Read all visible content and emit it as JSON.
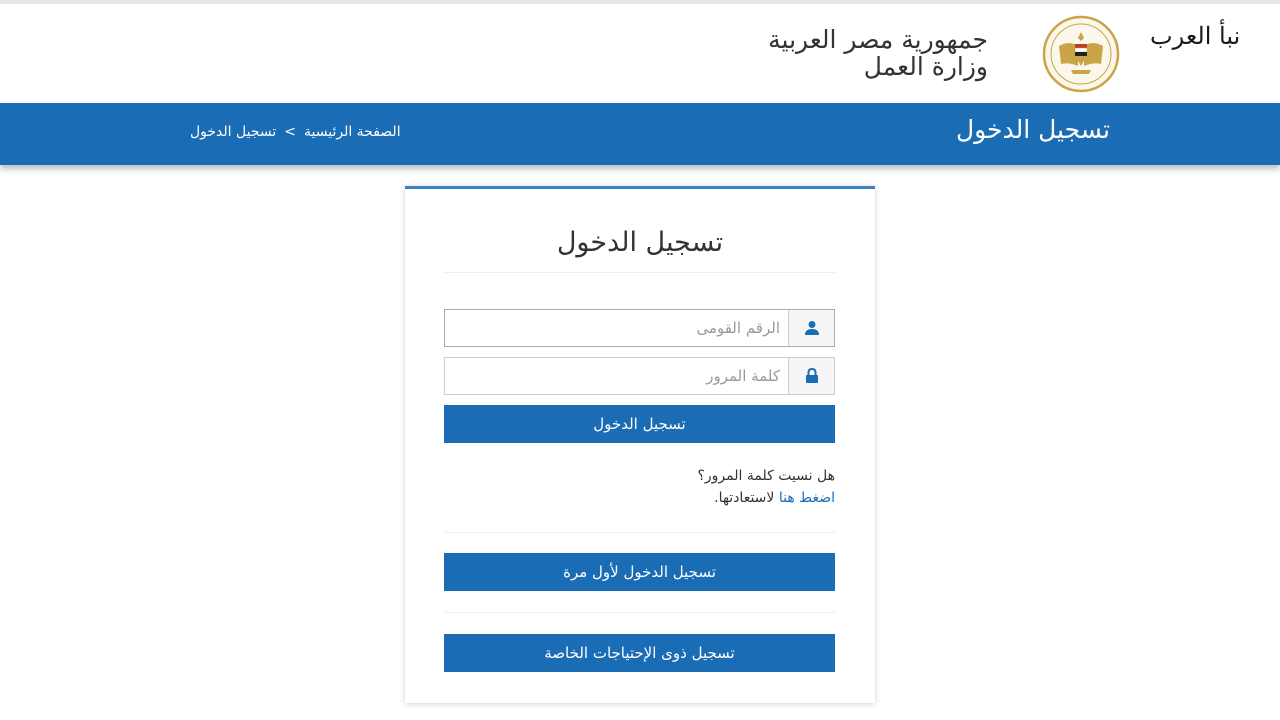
{
  "watermark": "نبأ العرب",
  "header": {
    "country": "جمهورية مصر العربية",
    "ministry": "وزارة العمل",
    "emblem_icon": "eagle-emblem-icon"
  },
  "bar": {
    "title": "تسجيل الدخول",
    "breadcrumb": {
      "home": "الصفحة الرئيسية",
      "separator": ">",
      "current": "تسجيل الدخول"
    }
  },
  "login": {
    "title": "تسجيل الدخول",
    "national_id": {
      "placeholder": "الرقم القومى",
      "value": "",
      "icon": "user-icon"
    },
    "password": {
      "placeholder": "كلمة المرور",
      "value": "",
      "icon": "lock-icon"
    },
    "submit_label": "تسجيل الدخول",
    "forgot_question": "هل نسيت كلمة المرور؟",
    "forgot_link": "اضغط هنا",
    "forgot_suffix": "لاستعادتها.",
    "first_time_label": "تسجيل الدخول لأول مرة",
    "special_needs_label": "تسجيل ذوى الإحتياجات الخاصة"
  },
  "colors": {
    "brand_blue": "#1a6cb5",
    "card_border": "#3a82c6"
  }
}
